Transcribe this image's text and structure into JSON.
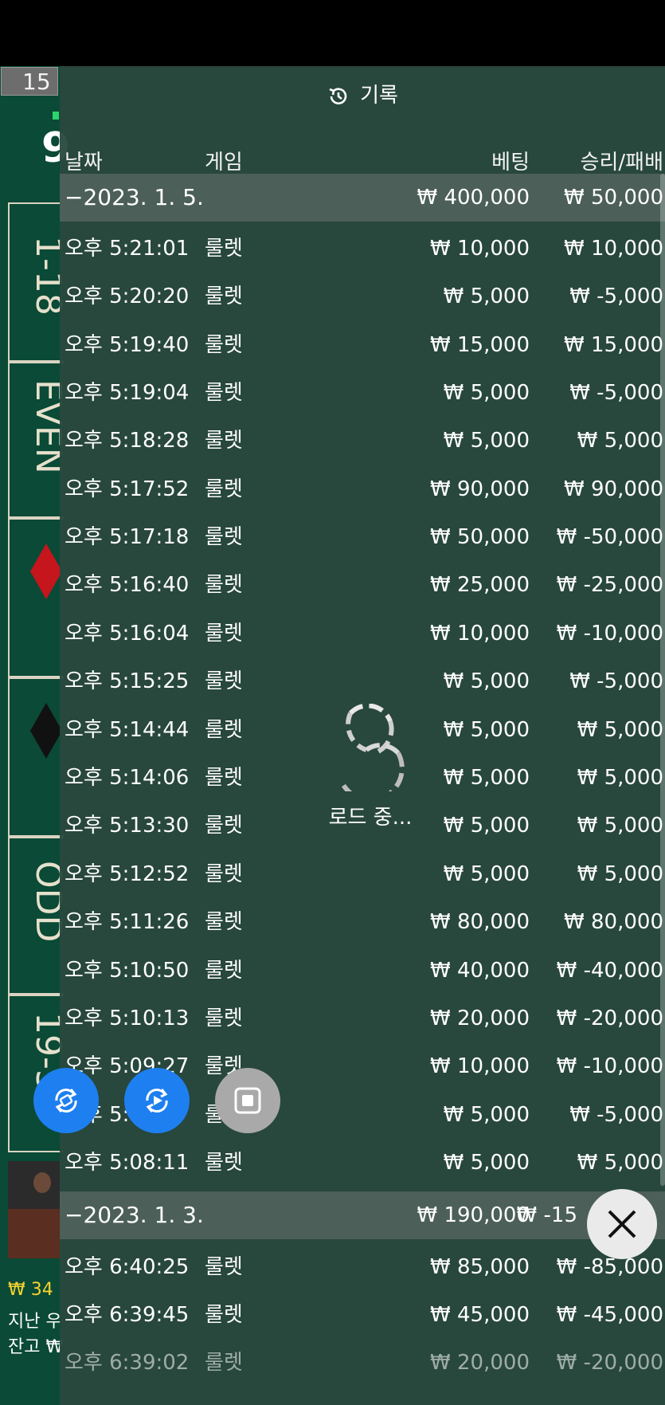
{
  "header": {
    "title": "기록"
  },
  "columns": {
    "date": "날짜",
    "game": "게임",
    "bet": "베팅",
    "winloss": "승리/패배"
  },
  "left_table": {
    "badge_number": "15",
    "big_digit": "9",
    "labels": [
      "1-18",
      "EVEN",
      "ODD",
      "19-3"
    ],
    "balance_line": "₩ 34",
    "last_line": "지난 우",
    "remaining_line": "잔고 ₩"
  },
  "groups": [
    {
      "date": "−2023. 1. 5.",
      "total_bet": "₩ 400,000",
      "total_winloss": "₩ 50,000",
      "rows": [
        {
          "time": "오후 5:21:01",
          "game": "룰렛",
          "bet": "₩ 10,000",
          "winloss": "₩ 10,000"
        },
        {
          "time": "오후 5:20:20",
          "game": "룰렛",
          "bet": "₩ 5,000",
          "winloss": "₩ -5,000"
        },
        {
          "time": "오후 5:19:40",
          "game": "룰렛",
          "bet": "₩ 15,000",
          "winloss": "₩ 15,000"
        },
        {
          "time": "오후 5:19:04",
          "game": "룰렛",
          "bet": "₩ 5,000",
          "winloss": "₩ -5,000"
        },
        {
          "time": "오후 5:18:28",
          "game": "룰렛",
          "bet": "₩ 5,000",
          "winloss": "₩ 5,000"
        },
        {
          "time": "오후 5:17:52",
          "game": "룰렛",
          "bet": "₩ 90,000",
          "winloss": "₩ 90,000"
        },
        {
          "time": "오후 5:17:18",
          "game": "룰렛",
          "bet": "₩ 50,000",
          "winloss": "₩ -50,000"
        },
        {
          "time": "오후 5:16:40",
          "game": "룰렛",
          "bet": "₩ 25,000",
          "winloss": "₩ -25,000"
        },
        {
          "time": "오후 5:16:04",
          "game": "룰렛",
          "bet": "₩ 10,000",
          "winloss": "₩ -10,000"
        },
        {
          "time": "오후 5:15:25",
          "game": "룰렛",
          "bet": "₩ 5,000",
          "winloss": "₩ -5,000"
        },
        {
          "time": "오후 5:14:44",
          "game": "룰렛",
          "bet": "₩ 5,000",
          "winloss": "₩ 5,000"
        },
        {
          "time": "오후 5:14:06",
          "game": "룰렛",
          "bet": "₩ 5,000",
          "winloss": "₩ 5,000"
        },
        {
          "time": "오후 5:13:30",
          "game": "룰렛",
          "bet": "₩ 5,000",
          "winloss": "₩ 5,000"
        },
        {
          "time": "오후 5:12:52",
          "game": "룰렛",
          "bet": "₩ 5,000",
          "winloss": "₩ 5,000"
        },
        {
          "time": "오후 5:11:26",
          "game": "룰렛",
          "bet": "₩ 80,000",
          "winloss": "₩ 80,000"
        },
        {
          "time": "오후 5:10:50",
          "game": "룰렛",
          "bet": "₩ 40,000",
          "winloss": "₩ -40,000"
        },
        {
          "time": "오후 5:10:13",
          "game": "룰렛",
          "bet": "₩ 20,000",
          "winloss": "₩ -20,000"
        },
        {
          "time": "오후 5:09:27",
          "game": "룰렛",
          "bet": "₩ 10,000",
          "winloss": "₩ -10,000"
        },
        {
          "time": "오후 5:",
          "game": "룰",
          "bet": "₩ 5,000",
          "winloss": "₩ -5,000"
        },
        {
          "time": "오후 5:08:11",
          "game": "룰렛",
          "bet": "₩ 5,000",
          "winloss": "₩ 5,000"
        }
      ]
    },
    {
      "date": "−2023. 1. 3.",
      "total_bet": "₩ 190,000",
      "total_winloss": "₩ -15",
      "rows": [
        {
          "time": "오후 6:40:25",
          "game": "룰렛",
          "bet": "₩ 85,000",
          "winloss": "₩ -85,000"
        },
        {
          "time": "오후 6:39:45",
          "game": "룰렛",
          "bet": "₩ 45,000",
          "winloss": "₩ -45,000"
        },
        {
          "time": "오후 6:39:02",
          "game": "룰렛",
          "bet": "₩ 20,000",
          "winloss": "₩ -20,000"
        }
      ]
    }
  ],
  "loader": {
    "text": "로드 중..."
  },
  "icons": [
    "history-icon",
    "loading-spinner-icon",
    "auto-rotate-icon",
    "replay-icon",
    "stop-icon",
    "close-icon"
  ],
  "colors": {
    "panel": "#2a4a40",
    "date_row": "#4c5f59",
    "fab_blue": "#1e7ff0",
    "balance_yellow": "#f6d230"
  }
}
